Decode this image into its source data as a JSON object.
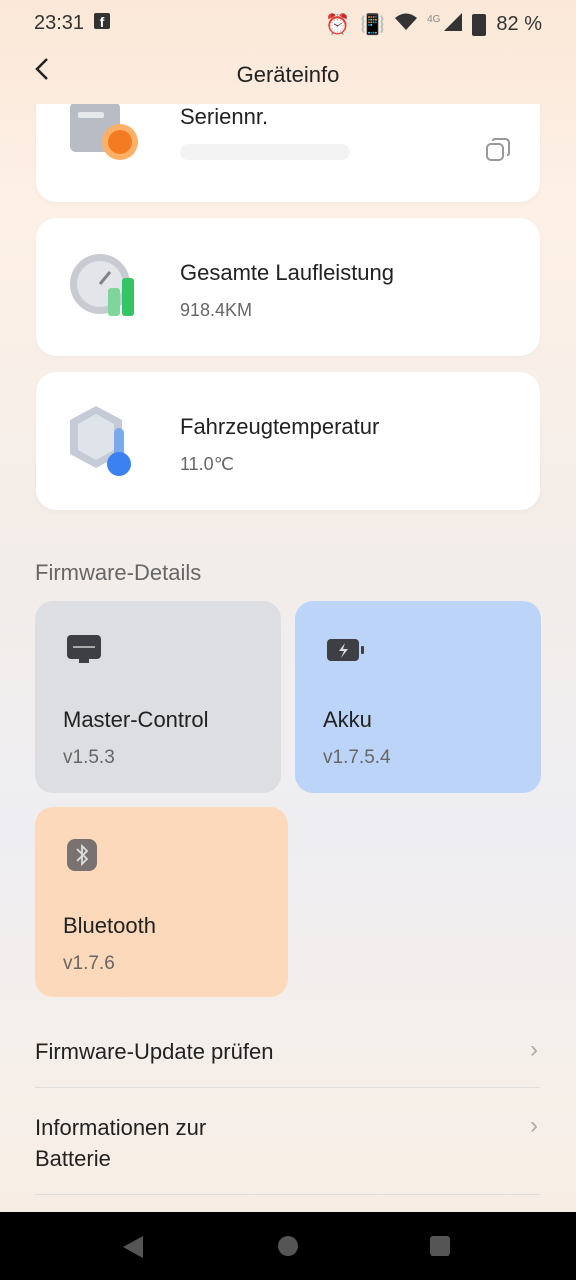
{
  "status": {
    "time": "23:31",
    "network": "4G",
    "battery": "82 %"
  },
  "header": {
    "title": "Geräteinfo"
  },
  "cards": [
    {
      "label": "Seriennr.",
      "value": ""
    },
    {
      "label": "Gesamte Laufleistung",
      "value": "918.4KM"
    },
    {
      "label": "Fahrzeugtemperatur",
      "value": "11.0℃"
    }
  ],
  "firmware": {
    "title": "Firmware-Details",
    "tiles": [
      {
        "name": "Master-Control",
        "version": "v1.5.3",
        "color": "#dcdee2"
      },
      {
        "name": "Akku",
        "version": "v1.7.5.4",
        "color": "#bcd4f8"
      },
      {
        "name": "Bluetooth",
        "version": "v1.7.6",
        "color": "#fbd9ba"
      }
    ]
  },
  "list": {
    "update": "Firmware-Update prüfen",
    "battery_info_line1": "Informationen zur",
    "battery_info_line2": "Batterie"
  }
}
